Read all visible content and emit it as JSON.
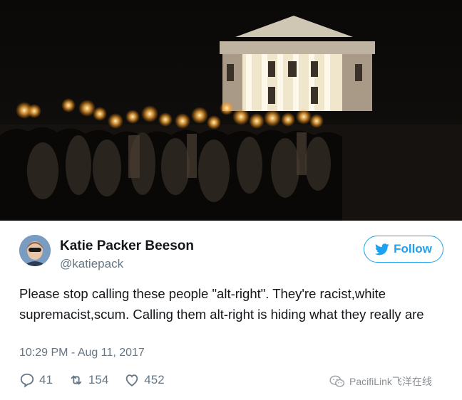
{
  "tweet": {
    "display_name": "Katie Packer Beeson",
    "handle": "@katiepack",
    "follow_label": "Follow",
    "text": "Please stop calling these people \"alt-right\". They're racist,white supremacist,scum. Calling them alt-right is hiding what they really are",
    "timestamp": "10:29 PM - Aug 11, 2017",
    "replies": "41",
    "retweets": "154",
    "likes": "452"
  },
  "watermark": {
    "text": "PacifiLink飞洋在线"
  },
  "colors": {
    "accent": "#1da1f2",
    "secondary_text": "#657786",
    "primary_text": "#14171a"
  },
  "icons": {
    "reply": "reply-icon",
    "retweet": "retweet-icon",
    "like": "heart-icon",
    "follow": "twitter-bird-icon"
  }
}
